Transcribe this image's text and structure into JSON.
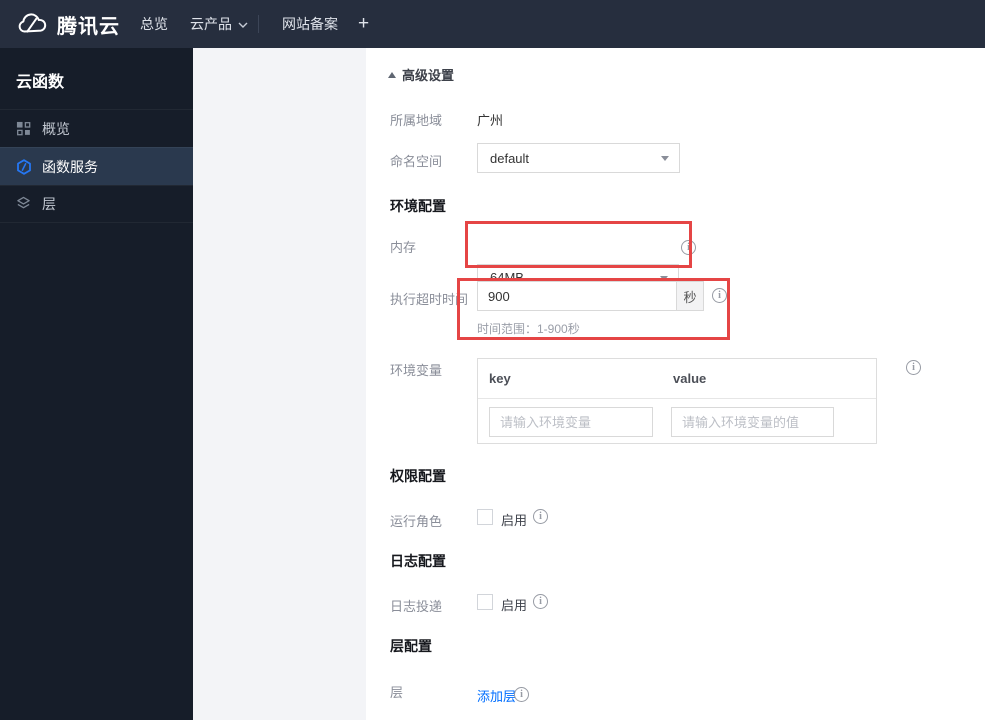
{
  "topbar": {
    "brand": "腾讯云",
    "nav": [
      {
        "label": "总览"
      },
      {
        "label": "云产品"
      },
      {
        "label": "网站备案"
      }
    ],
    "plus_label": "+"
  },
  "sidebar": {
    "title": "云函数",
    "items": [
      {
        "label": "概览",
        "icon": "grid-icon",
        "active": false
      },
      {
        "label": "函数服务",
        "icon": "scf-hexagon-icon",
        "active": true
      },
      {
        "label": "层",
        "icon": "layers-icon",
        "active": false
      }
    ]
  },
  "content": {
    "advanced_settings_label": "高级设置",
    "region": {
      "label": "所属地域",
      "value": "广州"
    },
    "namespace": {
      "label": "命名空间",
      "value": "default"
    },
    "section_env": "环境配置",
    "memory": {
      "label": "内存",
      "value": "64MB"
    },
    "timeout": {
      "label": "执行超时时间",
      "value": "900",
      "unit": "秒",
      "hint": "时间范围：1-900秒"
    },
    "env_vars": {
      "label": "环境变量",
      "key_header": "key",
      "value_header": "value",
      "key_placeholder": "请输入环境变量",
      "value_placeholder": "请输入环境变量的值"
    },
    "section_perm": "权限配置",
    "role": {
      "label": "运行角色",
      "enable_label": "启用"
    },
    "section_log": "日志配置",
    "log_delivery": {
      "label": "日志投递",
      "enable_label": "启用"
    },
    "section_layer": "层配置",
    "layer": {
      "label": "层",
      "add_link": "添加层"
    }
  },
  "colors": {
    "topbar_bg": "#262e3e",
    "sidebar_bg": "#161d29",
    "sidebar_active_bg": "#2a394e",
    "gray_panel_bg": "#f3f4f7",
    "link_blue": "#006eff",
    "highlight_red": "#e54545",
    "scf_icon_blue": "#2577f3"
  }
}
